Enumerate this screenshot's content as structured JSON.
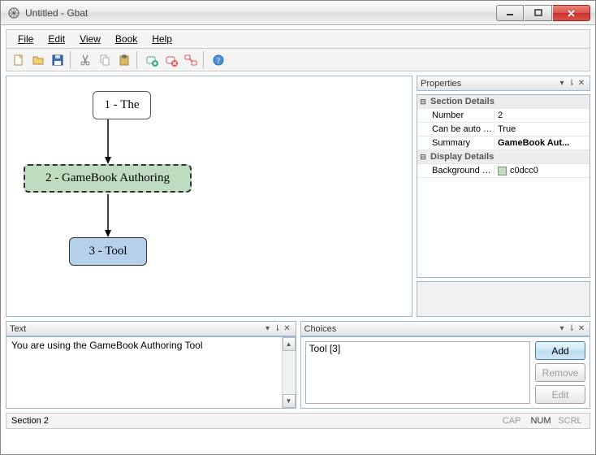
{
  "window": {
    "title": "Untitled - Gbat"
  },
  "menu": {
    "file": "File",
    "edit": "Edit",
    "view": "View",
    "book": "Book",
    "help": "Help"
  },
  "canvas": {
    "nodes": {
      "n1": "1 - The",
      "n2": "2 - GameBook Authoring",
      "n3": "3 - Tool"
    }
  },
  "properties": {
    "panelTitle": "Properties",
    "cat1": "Section Details",
    "row_number_label": "Number",
    "row_number_value": "2",
    "row_auto_label": "Can be auto s...",
    "row_auto_value": "True",
    "row_summary_label": "Summary",
    "row_summary_value": "GameBook Aut...",
    "cat2": "Display Details",
    "row_bg_label": "Background C...",
    "row_bg_value": "c0dcc0"
  },
  "textPanel": {
    "title": "Text",
    "content": "You are using the GameBook Authoring Tool"
  },
  "choicesPanel": {
    "title": "Choices",
    "item0": "Tool [3]",
    "addLabel": "Add",
    "removeLabel": "Remove",
    "editLabel": "Edit"
  },
  "status": {
    "left": "Section 2",
    "cap": "CAP",
    "num": "NUM",
    "scrl": "SCRL"
  }
}
